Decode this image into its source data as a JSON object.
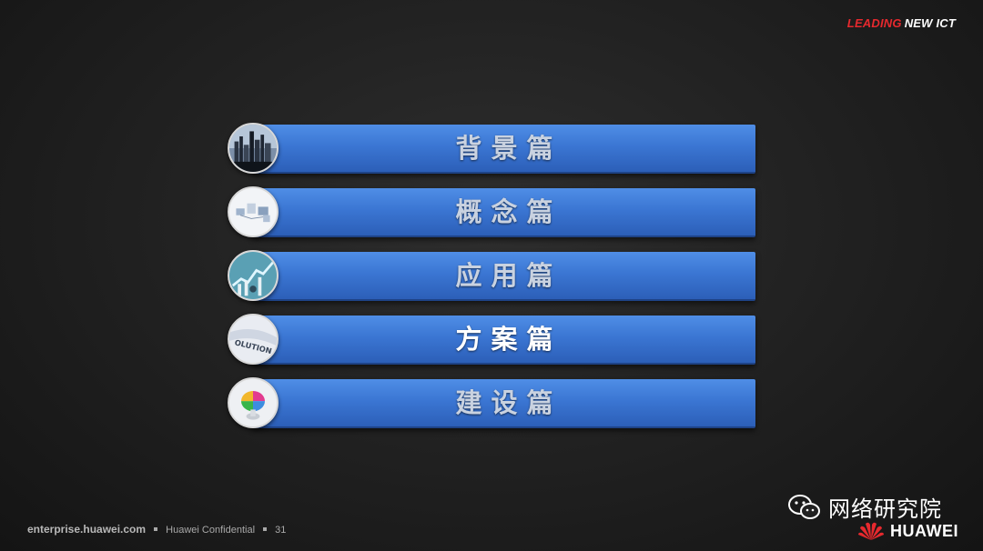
{
  "header": {
    "tagline_part1": "LEADING",
    "tagline_part2": "NEW ICT"
  },
  "menu": {
    "items": [
      {
        "label": "背景篇",
        "thumb_icon": "city-skyline-icon",
        "active": false
      },
      {
        "label": "概念篇",
        "thumb_icon": "network-devices-icon",
        "active": false
      },
      {
        "label": "应用篇",
        "thumb_icon": "growth-chart-icon",
        "active": false
      },
      {
        "label": "方案篇",
        "thumb_icon": "solution-text-icon",
        "active": true
      },
      {
        "label": "建设篇",
        "thumb_icon": "puzzle-sphere-icon",
        "active": false
      }
    ],
    "solution_thumb_text": "OLUTION"
  },
  "footer": {
    "site": "enterprise.huawei.com",
    "confidential": "Huawei Confidential",
    "page_number": "31"
  },
  "watermark": {
    "wechat_text": "网络研究院",
    "huawei_text": "HUAWEI"
  },
  "colors": {
    "bar_top": "#4f8ee6",
    "bar_bottom": "#2c5fb8",
    "brand_red": "#e6292e",
    "background": "#222222"
  }
}
